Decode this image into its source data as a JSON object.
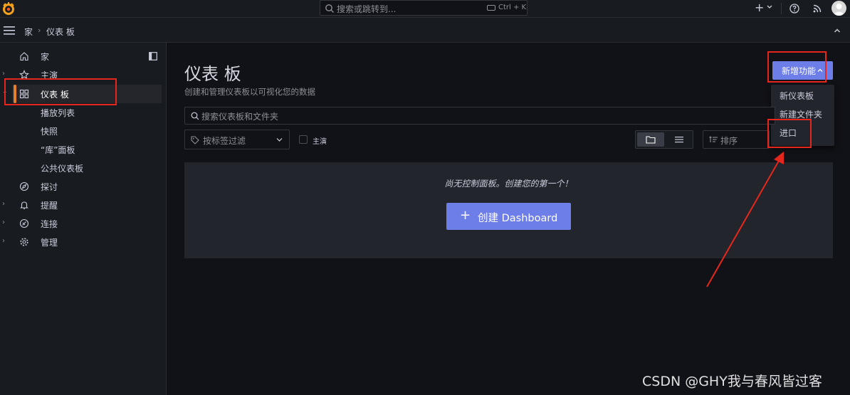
{
  "topbar": {
    "search_placeholder": "搜索或跳转到...",
    "shortcut": "Ctrl + K",
    "plus_label": "+"
  },
  "breadcrumb": {
    "home": "家",
    "separator": "›",
    "current": "仪表 板"
  },
  "sidebar": {
    "items": [
      {
        "label": "家",
        "icon": "home-icon",
        "expandable": false
      },
      {
        "label": "主演",
        "icon": "star-icon",
        "expandable": true
      },
      {
        "label": "仪表 板",
        "icon": "dashboards-icon",
        "expandable": true,
        "active": true
      },
      {
        "label": "播放列表",
        "sub": true
      },
      {
        "label": "快照",
        "sub": true
      },
      {
        "label": "“库”面板",
        "sub": true
      },
      {
        "label": "公共仪表板",
        "sub": true
      },
      {
        "label": "探讨",
        "icon": "compass-icon",
        "expandable": false
      },
      {
        "label": "提醒",
        "icon": "bell-icon",
        "expandable": true
      },
      {
        "label": "连接",
        "icon": "link-icon",
        "expandable": true
      },
      {
        "label": "管理",
        "icon": "gear-icon",
        "expandable": true
      }
    ]
  },
  "main": {
    "title": "仪表 板",
    "subtitle": "创建和管理仪表板以可视化您的数据",
    "new_button": "新增功能",
    "dropdown": [
      "新仪表板",
      "新建文件夹",
      "进口"
    ],
    "search_placeholder": "搜索仪表板和文件夹",
    "tag_filter": "按标签过滤",
    "starred_label": "主演",
    "sort_placeholder": "排序",
    "empty_text": "尚无控制面板。创建您的第一个！",
    "create_button": "创建 Dashboard",
    "create_plus": "+"
  },
  "watermark": "CSDN @GHY我与春风皆过客",
  "colors": {
    "accent": "#e67f2a",
    "primary": "#6e7ee8",
    "annotation": "#e5261d"
  }
}
